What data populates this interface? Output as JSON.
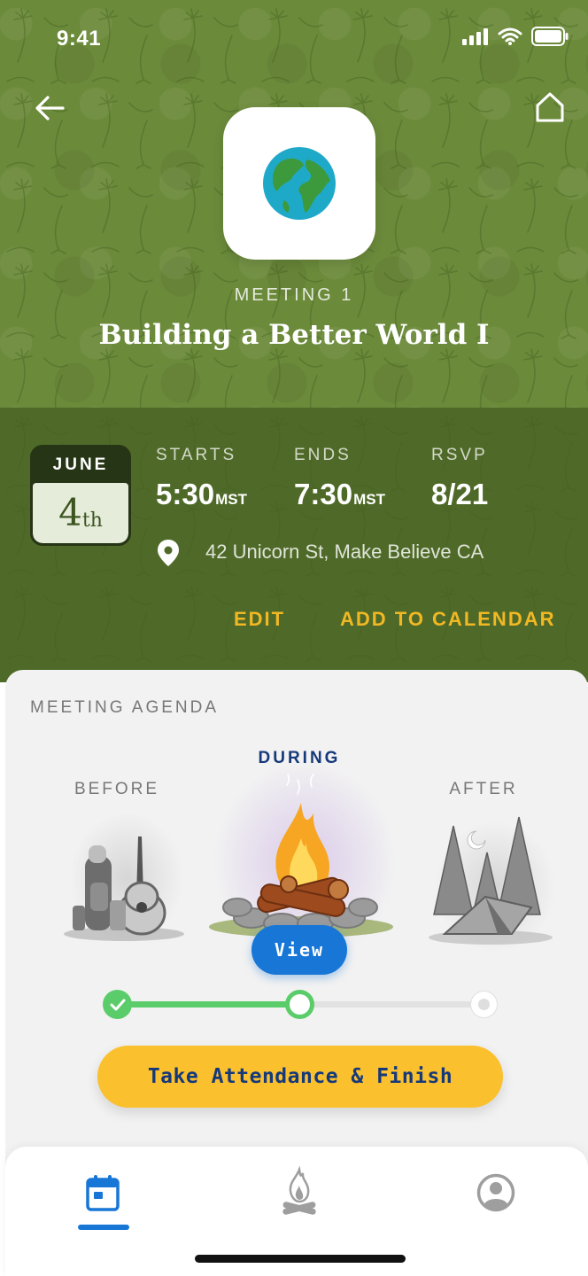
{
  "status_bar": {
    "time": "9:41"
  },
  "header": {
    "meeting_label": "MEETING 1",
    "title": "Building a Better World I",
    "app_icon": "globe-icon"
  },
  "details": {
    "month": "JUNE",
    "day": "4",
    "day_suffix": "th",
    "starts": {
      "label": "STARTS",
      "value": "5:30",
      "unit": "MST"
    },
    "ends": {
      "label": "ENDS",
      "value": "7:30",
      "unit": "MST"
    },
    "rsvp": {
      "label": "RSVP",
      "value": "8/21"
    },
    "address": "42 Unicorn St, Make Believe CA",
    "edit_label": "EDIT",
    "add_calendar_label": "ADD TO CALENDAR"
  },
  "agenda": {
    "title": "MEETING AGENDA",
    "phases": [
      {
        "label": "BEFORE",
        "state": "done",
        "image": "camping-gear"
      },
      {
        "label": "DURING",
        "state": "active",
        "image": "campfire"
      },
      {
        "label": "AFTER",
        "state": "upcoming",
        "image": "tent-forest"
      }
    ],
    "view_label": "View",
    "progress": 0.5,
    "finish_label": "Take Attendance & Finish"
  },
  "bottom_nav": {
    "items": [
      {
        "name": "calendar",
        "icon": "calendar-icon",
        "active": true
      },
      {
        "name": "campfire",
        "icon": "campfire-icon",
        "active": false
      },
      {
        "name": "profile",
        "icon": "profile-icon",
        "active": false
      }
    ]
  },
  "colors": {
    "header_green": "#6b8a3a",
    "details_green": "#4f6a28",
    "accent_yellow": "#f2b824",
    "primary_blue": "#1776d6",
    "progress_green": "#5bcc6a",
    "title_navy": "#15397a"
  }
}
